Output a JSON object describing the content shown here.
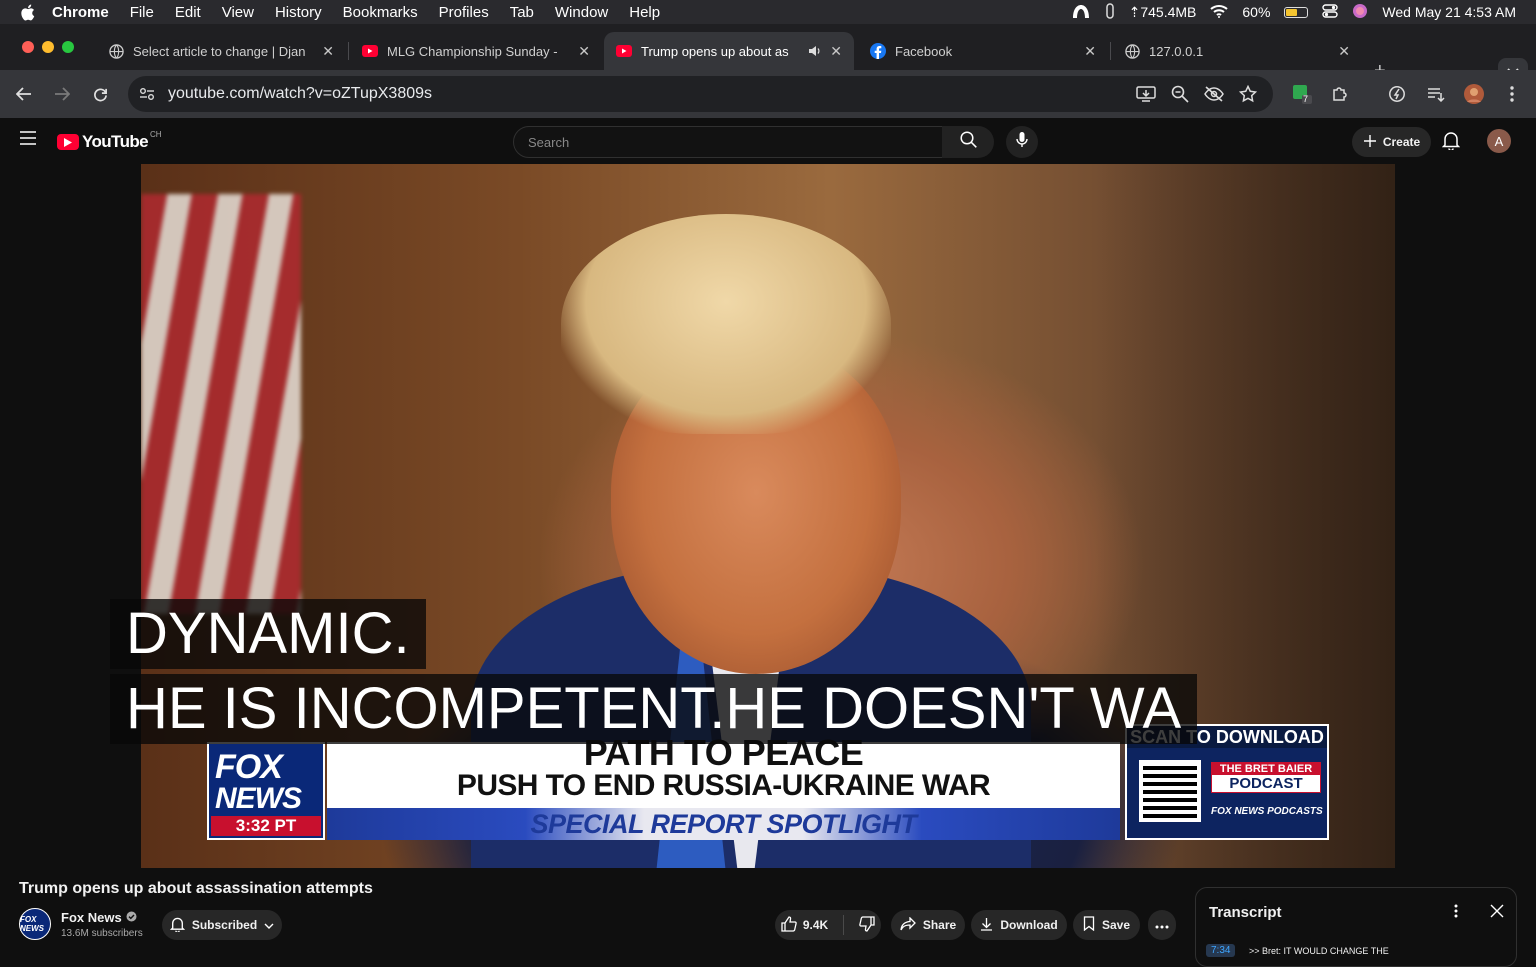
{
  "menubar": {
    "app": "Chrome",
    "items": [
      "File",
      "Edit",
      "View",
      "History",
      "Bookmarks",
      "Profiles",
      "Tab",
      "Window",
      "Help"
    ],
    "memory": "⇡745.4MB",
    "battery_percent": "60%",
    "battery_level": 0.6,
    "datetime": "Wed May 21  4:53 AM"
  },
  "tabs": [
    {
      "title": "Select article to change | Djan",
      "icon": "globe-icon"
    },
    {
      "title": "MLG Championship Sunday -",
      "icon": "youtube-icon"
    },
    {
      "title": "Trump opens up about as",
      "icon": "youtube-icon",
      "active": true,
      "audio": "speaker-icon"
    },
    {
      "title": "Facebook",
      "icon": "facebook-icon"
    },
    {
      "title": "127.0.0.1",
      "icon": "globe-icon"
    }
  ],
  "toolbar": {
    "url": "youtube.com/watch?v=oZTupX3809s",
    "extension_badge": "7"
  },
  "youtube": {
    "logo_text": "YouTube",
    "country_code": "CH",
    "search_placeholder": "Search",
    "create_label": "Create",
    "avatar_letter": "A"
  },
  "video": {
    "captions": [
      "DYNAMIC.",
      "HE IS INCOMPETENT.HE DOESN'T WA"
    ],
    "lower_third": {
      "logo_line1": "FOX",
      "logo_line2": "NEWS",
      "time": "3:32 PT",
      "headline": "PATH TO PEACE",
      "subhead": "PUSH TO END RUSSIA-UKRAINE WAR",
      "segment": "SPECIAL REPORT SPOTLIGHT",
      "scan_text": "SCAN TO DOWNLOAD",
      "podcast_line1": "THE BRET BAIER",
      "podcast_line2": "PODCAST",
      "podcast_brand": "FOX NEWS PODCASTS"
    }
  },
  "watch": {
    "title": "Trump opens up about assassination attempts",
    "channel_name": "Fox News",
    "channel_avatar_text": "FOX NEWS",
    "subscribers": "13.6M subscribers",
    "subscribed_label": "Subscribed",
    "likes": "9.4K",
    "share_label": "Share",
    "download_label": "Download",
    "save_label": "Save"
  },
  "transcript": {
    "title": "Transcript",
    "first_time": "7:34",
    "first_text": ">> Bret: IT WOULD CHANGE THE"
  },
  "colors": {
    "youtube_red": "#ff0033",
    "fox_blue": "#0a2878",
    "fox_red": "#c8102e"
  }
}
